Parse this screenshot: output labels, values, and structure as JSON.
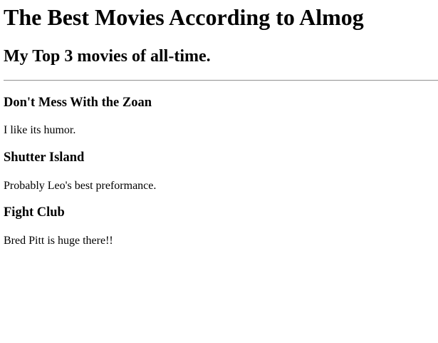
{
  "page": {
    "title": "The Best Movies According to Almog",
    "subtitle": "My Top 3 movies of all-time."
  },
  "movies": [
    {
      "title": "Don't Mess With the Zoan",
      "description": "I like its humor."
    },
    {
      "title": "Shutter Island",
      "description": "Probably Leo's best preformance."
    },
    {
      "title": "Fight Club",
      "description": "Bred Pitt is huge there!!"
    }
  ]
}
